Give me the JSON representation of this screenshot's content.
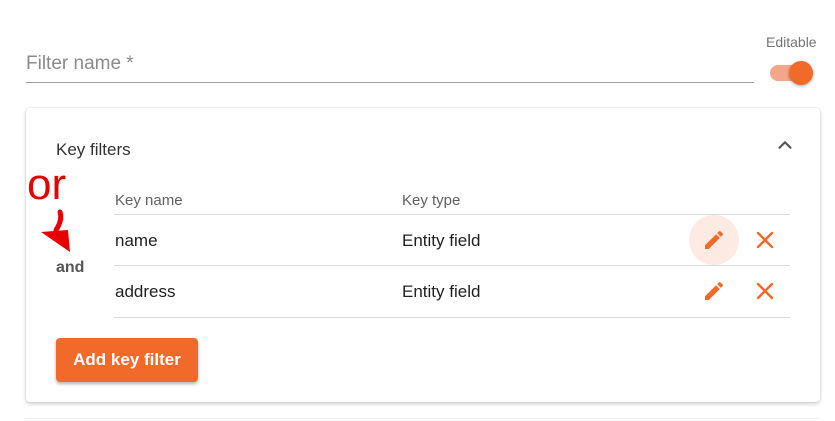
{
  "filter": {
    "placeholder": "Filter name *"
  },
  "editable": {
    "label": "Editable",
    "enabled": true
  },
  "key_filters": {
    "title": "Key filters",
    "columns": [
      "Key name",
      "Key type"
    ],
    "operator": "and",
    "rows": [
      {
        "key_name": "name",
        "key_type": "Entity field"
      },
      {
        "key_name": "address",
        "key_type": "Entity field"
      }
    ],
    "add_button": "Add key filter"
  },
  "annotation": {
    "text": "or"
  },
  "colors": {
    "accent": "#f26a2a",
    "annotation": "#e60000"
  },
  "icons": [
    "chevron-up-icon",
    "pencil-icon",
    "close-icon",
    "arrow-down-icon"
  ]
}
